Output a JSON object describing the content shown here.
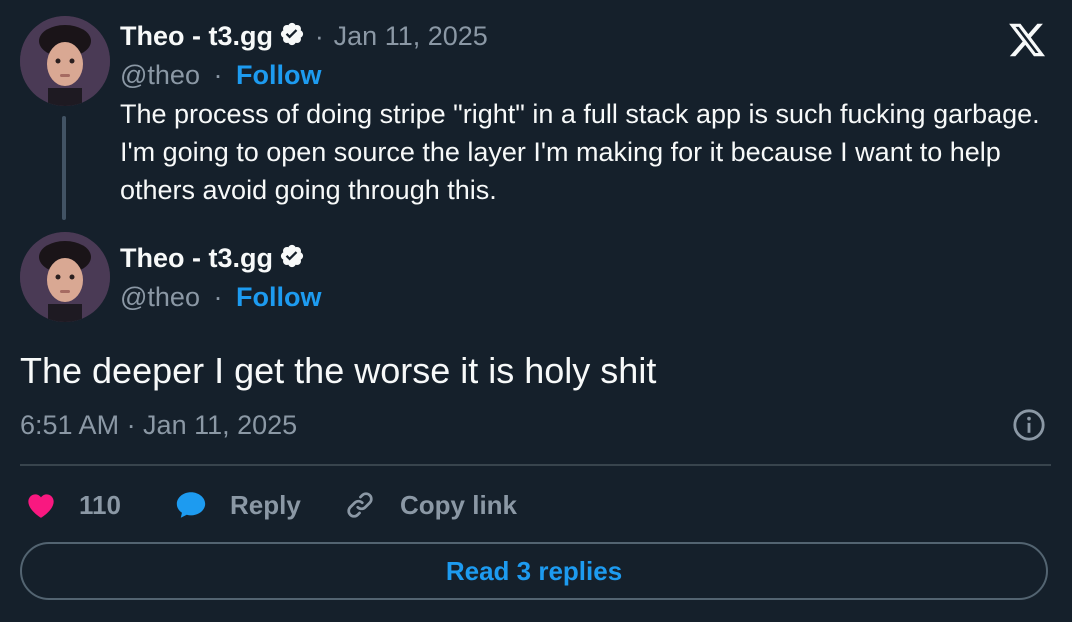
{
  "parent_tweet": {
    "author_name": "Theo - t3.gg",
    "handle": "@theo",
    "separator": "·",
    "date": "Jan 11, 2025",
    "follow_label": "Follow",
    "text": "The process of doing stripe \"right\" in a full stack app is such fucking garbage. I'm going to open source the layer I'm making for it because I want to help others avoid going through this."
  },
  "main_tweet": {
    "author_name": "Theo - t3.gg",
    "handle": "@theo",
    "separator": "·",
    "follow_label": "Follow",
    "text": "The deeper I get the worse it is holy shit",
    "timestamp": "6:51 AM · Jan 11, 2025"
  },
  "actions": {
    "like_count": "110",
    "reply_label": "Reply",
    "copy_link_label": "Copy link"
  },
  "read_replies_label": "Read 3 replies",
  "icons": {
    "logo": "x-logo-icon",
    "verified": "verified-badge-icon",
    "info": "info-icon",
    "like": "heart-icon",
    "reply": "reply-bubble-icon",
    "link": "link-icon"
  },
  "colors": {
    "background": "#15202b",
    "accent": "#1d9bf0",
    "like": "#f91880",
    "muted": "#8b98a5"
  }
}
